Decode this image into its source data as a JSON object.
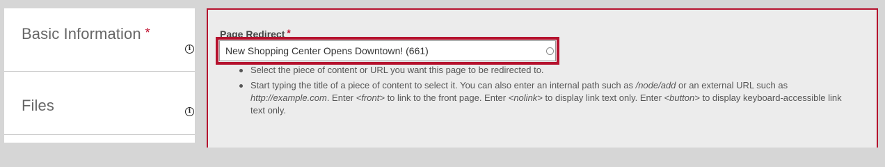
{
  "sidebar": {
    "items": [
      {
        "label": "Basic Information",
        "required": "*",
        "info_icon": "info-circle-icon"
      },
      {
        "label": "Files",
        "info_icon": "info-circle-icon"
      }
    ]
  },
  "field": {
    "label": "Page Redirect",
    "required": "*",
    "value": "New Shopping Center Opens Downtown! (661)",
    "autocomplete_icon": "autocomplete-throbber-icon"
  },
  "help": {
    "item1": "Select the piece of content or URL you want this page to be redirected to.",
    "item2": {
      "t1": "Start typing the title of a piece of content to select it. You can also enter an internal path such as ",
      "path_example": "/node/add",
      "t2": " or an external URL such as ",
      "url_example": "http://example.com",
      "t3": ". Enter ",
      "front_tag": "<front>",
      "t4": " to link to the front page. Enter ",
      "nolink_tag": "<nolink>",
      "t5": " to display link text only. Enter ",
      "button_tag": "<button>",
      "t6": " to display keyboard-accessible link text only."
    }
  },
  "colors": {
    "accent": "#b5122e",
    "panel_bg": "#ececec",
    "page_bg": "#d6d6d6"
  }
}
